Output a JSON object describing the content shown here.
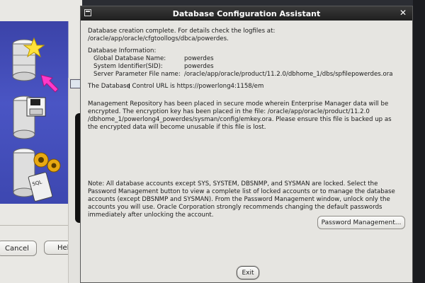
{
  "background_window": {
    "cancel_label": "Cancel",
    "help_label": "Hel"
  },
  "dialog": {
    "title": "Database Configuration Assistant",
    "completion_line1": "Database creation complete. For details check the logfiles at:",
    "completion_line2": " /oracle/app/oracle/cfgtoollogs/dbca/powerdes.",
    "info_heading": "Database Information:",
    "info": [
      {
        "label": "Global Database Name:",
        "value": "powerdes"
      },
      {
        "label": "System Identifier(SID):",
        "value": "powerdes"
      },
      {
        "label": "Server Parameter File name:",
        "value": "/oracle/app/oracle/product/11.2.0/dbhome_1/dbs/spfilepowerdes.ora"
      }
    ],
    "control_url": "The Database Control URL is https://powerlong4:1158/em",
    "repo_line1": "Management Repository has been placed in secure mode wherein Enterprise Manager data will be",
    "repo_line2": "encrypted.  The encryption key has been placed in the file: /oracle/app/oracle/product/11.2.0",
    "repo_line3": "/dbhome_1/powerlong4_powerdes/sysman/config/emkey.ora.   Please ensure this file is backed up as",
    "repo_line4": "the encrypted data will become unusable if this file is lost.",
    "note_line1": "Note: All database accounts except SYS, SYSTEM, DBSNMP, and SYSMAN are locked. Select the",
    "note_line2": "Password Management button to view a complete list of locked accounts or to manage the database",
    "note_line3": "accounts (except DBSNMP and SYSMAN). From the Password Management window, unlock only the",
    "note_line4": "accounts you will use. Oracle Corporation strongly recommends changing the default passwords",
    "note_line5": "immediately after unlocking the account.",
    "password_button": "Password Management...",
    "exit_button": "Exit"
  }
}
